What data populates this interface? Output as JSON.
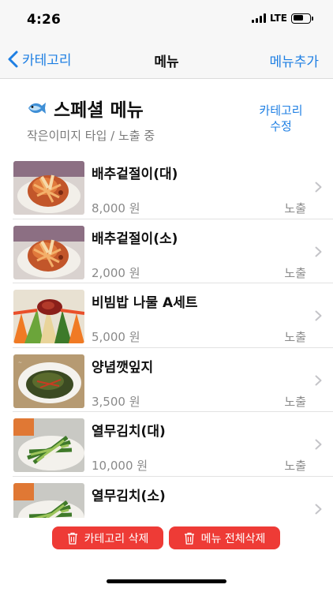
{
  "status_bar": {
    "time": "4:26",
    "network": "LTE"
  },
  "nav": {
    "back_label": "카테고리",
    "title": "메뉴",
    "action_label": "메뉴추가"
  },
  "category": {
    "icon": "fish-icon",
    "title": "스페셜 메뉴",
    "subtitle": "작은이미지 타입 / 노출 중",
    "edit_label": "카테고리\n수정",
    "edit_line1": "카테고리",
    "edit_line2": "수정"
  },
  "menu_items": [
    {
      "name": "배추겉절이(대)",
      "price": "8,000 원",
      "status": "노출",
      "thumb": "kimchi"
    },
    {
      "name": "배추겉절이(소)",
      "price": "2,000 원",
      "status": "노출",
      "thumb": "kimchi"
    },
    {
      "name": "비빔밥 나물 A세트",
      "price": "5,000 원",
      "status": "노출",
      "thumb": "namul"
    },
    {
      "name": "양념깻잎지",
      "price": "3,500 원",
      "status": "노출",
      "thumb": "perilla"
    },
    {
      "name": "열무김치(대)",
      "price": "10,000 원",
      "status": "노출",
      "thumb": "yeolmu"
    },
    {
      "name": "열무김치(소)",
      "price": "",
      "status": "",
      "thumb": "yeolmu"
    }
  ],
  "bottom": {
    "delete_category_label": "카테고리 삭제",
    "delete_all_label": "메뉴 전체삭제"
  },
  "colors": {
    "accent": "#1e7fe3",
    "danger": "#ee3b36",
    "muted": "#8a8a8a"
  }
}
